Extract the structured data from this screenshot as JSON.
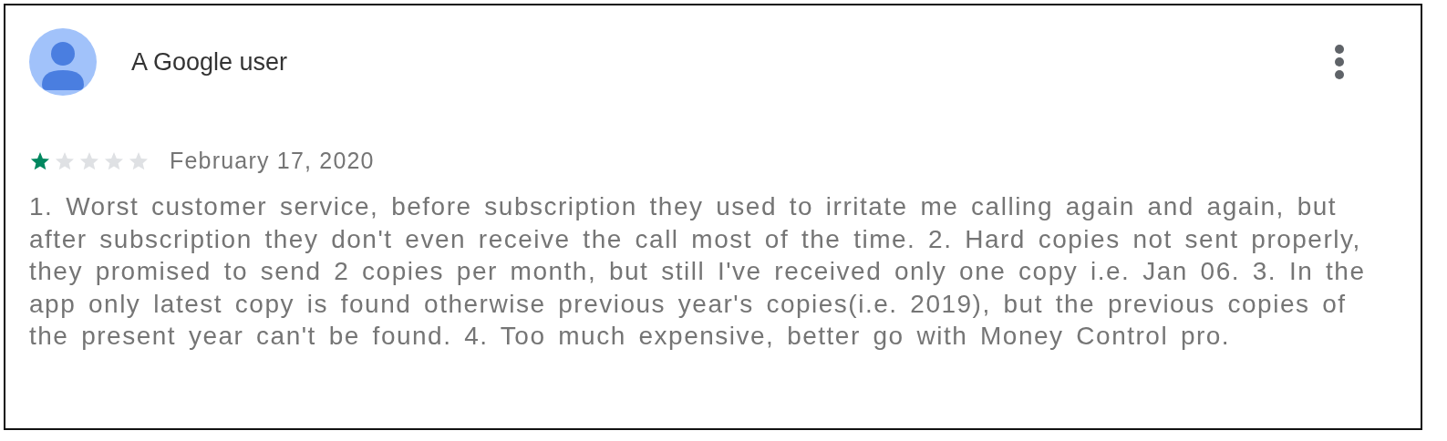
{
  "review": {
    "author": "A Google user",
    "stars": 1,
    "date": "February 17, 2020",
    "text": "1. Worst customer service, before subscription they used to irritate me calling again and again, but after subscription they don't even receive the call most of the time. 2. Hard copies not sent properly, they promised to send 2 copies per month, but still I've received only one copy i.e. Jan 06. 3. In the app only latest copy is found otherwise previous year's copies(i.e. 2019), but the previous copies of the present year can't be found. 4. Too much expensive, better go with Money Control pro."
  }
}
